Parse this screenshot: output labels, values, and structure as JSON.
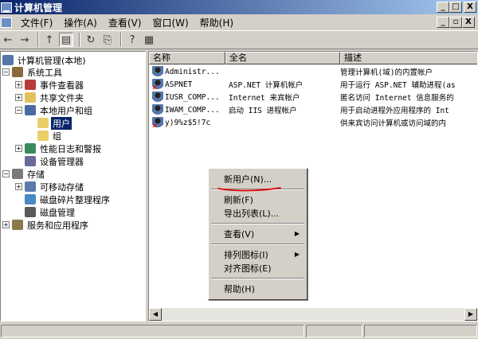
{
  "window": {
    "title": "计算机管理",
    "min": "_",
    "max": "□",
    "close": "X"
  },
  "menu": {
    "items": [
      "文件(F)",
      "操作(A)",
      "查看(V)",
      "窗口(W)",
      "帮助(H)"
    ],
    "mdi_min": "_",
    "mdi_restore": "▫",
    "mdi_close": "X"
  },
  "toolbar": {
    "back": "←",
    "forward": "→",
    "up": "↑",
    "show_tree": "▤",
    "refresh": "↻",
    "export": "⎘",
    "help": "?",
    "console": "▦"
  },
  "tree": {
    "items": [
      {
        "label": "计算机管理(本地)",
        "icon": "computer-icon",
        "color": "#5577aa"
      },
      {
        "label": "系统工具",
        "icon": "tools-icon",
        "color": "#8a6a3a",
        "exp": "−"
      },
      {
        "label": "事件查看器",
        "icon": "event-viewer-icon",
        "color": "#b83a3a",
        "exp": "+"
      },
      {
        "label": "共享文件夹",
        "icon": "shared-folder-icon",
        "color": "#e2c15a",
        "exp": "+"
      },
      {
        "label": "本地用户和组",
        "icon": "users-icon",
        "color": "#4a6aa5",
        "exp": "−"
      },
      {
        "label": "用户",
        "icon": "folder-icon",
        "color": "#e8cf6a"
      },
      {
        "label": "组",
        "icon": "folder-icon",
        "color": "#e8cf6a"
      },
      {
        "label": "性能日志和警报",
        "icon": "performance-icon",
        "color": "#3a8a5a",
        "exp": "+"
      },
      {
        "label": "设备管理器",
        "icon": "device-manager-icon",
        "color": "#6a6a9a"
      },
      {
        "label": "存储",
        "icon": "storage-icon",
        "color": "#7a7a7a",
        "exp": "−"
      },
      {
        "label": "可移动存储",
        "icon": "removable-storage-icon",
        "color": "#5a7aaa",
        "exp": "+"
      },
      {
        "label": "磁盘碎片整理程序",
        "icon": "defrag-icon",
        "color": "#4a8ac4"
      },
      {
        "label": "磁盘管理",
        "icon": "disk-management-icon",
        "color": "#5a5a5a"
      },
      {
        "label": "服务和应用程序",
        "icon": "services-icon",
        "color": "#8a7a4a",
        "exp": "+"
      }
    ]
  },
  "list": {
    "columns": [
      "名称",
      "全名",
      "描述"
    ],
    "rows": [
      {
        "name": "Administr...",
        "full": "",
        "desc": "管理计算机(域)的内置帐户",
        "disabled": false
      },
      {
        "name": "ASPNET",
        "full": "ASP.NET 计算机帐户",
        "desc": "用于运行 ASP.NET 辅助进程(as",
        "disabled": true
      },
      {
        "name": "IUSR_COMP...",
        "full": "Internet 来宾帐户",
        "desc": "匿名访问 Internet 信息服务的",
        "disabled": false
      },
      {
        "name": "IWAM_COMP...",
        "full": "启动 IIS 进程帐户",
        "desc": "用于启动进程外应用程序的 Int",
        "disabled": false
      },
      {
        "name": "y)9%z$5!7c",
        "full": "",
        "desc": "供来宾访问计算机或访问域的内",
        "disabled": true
      }
    ]
  },
  "context_menu": {
    "new_user": "新用户(N)...",
    "refresh": "刷新(F)",
    "export_list": "导出列表(L)...",
    "view": "查看(V)",
    "arrange_icons": "排列图标(I)",
    "line_up_icons": "对齐图标(E)",
    "help": "帮助(H)",
    "highlight_color": "#e00000"
  }
}
